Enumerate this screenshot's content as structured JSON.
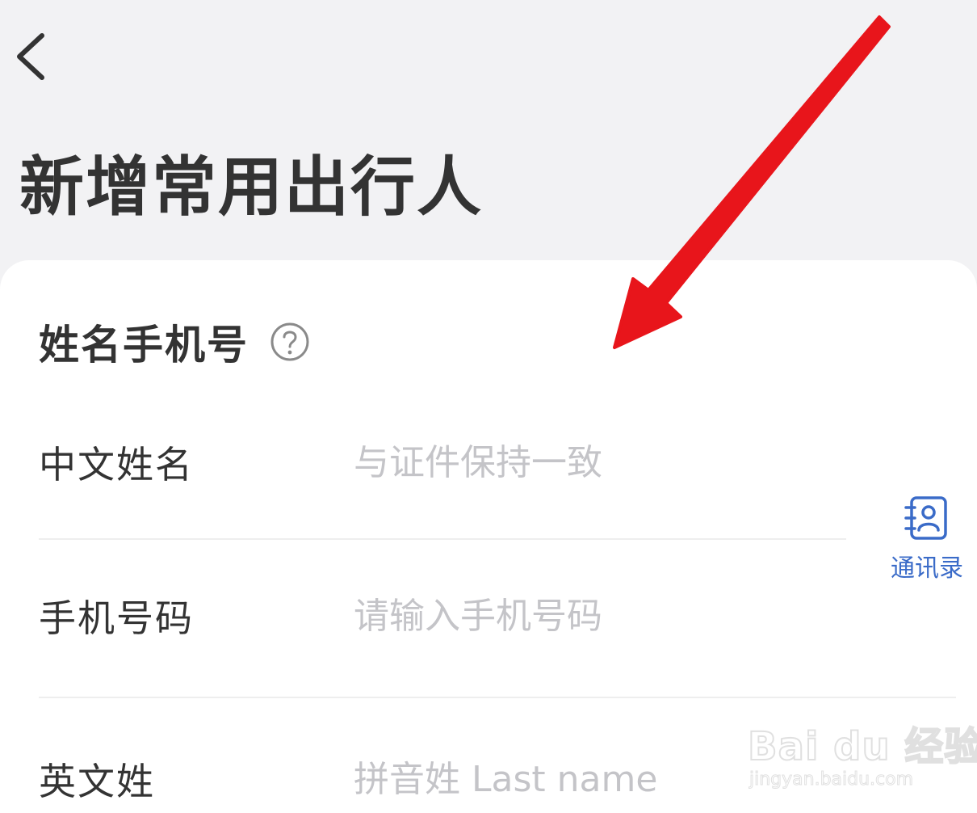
{
  "header": {
    "title": "新增常用出行人"
  },
  "section": {
    "title": "姓名手机号"
  },
  "form": {
    "rows": [
      {
        "label": "中文姓名",
        "placeholder": "与证件保持一致",
        "value": ""
      },
      {
        "label": "手机号码",
        "placeholder": "请输入手机号码",
        "value": ""
      },
      {
        "label": "英文姓",
        "placeholder": "拼音姓 Last name",
        "value": ""
      }
    ]
  },
  "contacts": {
    "label": "通讯录"
  },
  "watermark": {
    "brand": "Bai du 经验",
    "url": "jingyan.baidu.com"
  },
  "icons": {
    "back": "chevron-left-icon",
    "help": "question-circle-icon",
    "contacts": "address-book-icon"
  },
  "colors": {
    "page_background": "#f2f2f4",
    "card_background": "#ffffff",
    "title_text": "#333333",
    "placeholder_text": "#c4c4c8",
    "accent_blue": "#3a6bc8",
    "annotation_arrow": "#e8151b"
  }
}
